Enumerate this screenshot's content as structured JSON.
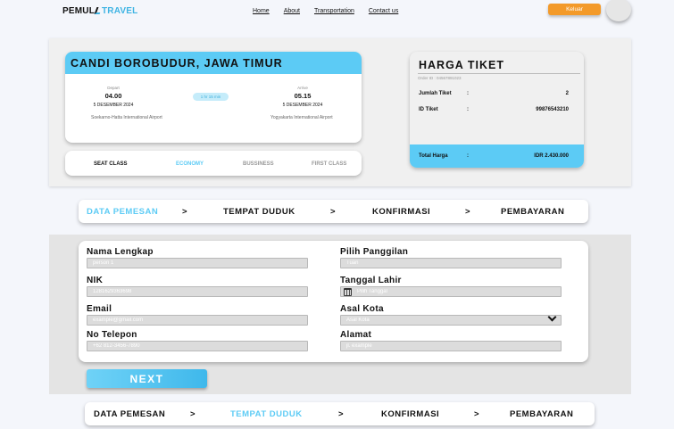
{
  "nav": {
    "logo_part1": "PEMUL",
    "logo_part2": "TRAVEL",
    "links": [
      "Home",
      "About",
      "Transportation",
      "Contact us"
    ],
    "logout_label": "Keluar"
  },
  "trip": {
    "title": "CANDI BOROBUDUR, JAWA TIMUR",
    "depart_label": "Depart",
    "depart_time": "04.00",
    "depart_date": "5 DESEMBER 2024",
    "depart_airport": "Soekarno-Hatta International Airport",
    "duration": "1 hr 15 min",
    "arrive_label": "Arrive",
    "arrive_time": "05.15",
    "arrive_date": "5 DESEMBER 2024",
    "arrive_airport": "Yogyakarta International Airport"
  },
  "classes": {
    "seat_label": "SEAT CLASS",
    "options": [
      "ECONOMY",
      "BUSSINESS",
      "FIRST CLASS"
    ],
    "selected": "ECONOMY"
  },
  "price": {
    "title": "HARGA TIKET",
    "order_id": "Order ID : 04567891023",
    "rows": [
      {
        "label": "Jumlah Tiket",
        "value": "2"
      },
      {
        "label": "ID Tiket",
        "value": "99876543210"
      }
    ],
    "total_label": "Total Harga",
    "total_value": "IDR 2.430.000",
    "separator": ":"
  },
  "steps": {
    "items": [
      "DATA PEMESAN",
      "TEMPAT DUDUK",
      "KONFIRMASI",
      "PEMBAYARAN"
    ],
    "arrow": ">"
  },
  "form": {
    "nama": {
      "label": "Nama Lengkap",
      "placeholder": "person 1"
    },
    "panggilan": {
      "label": "Pilih Panggilan",
      "placeholder": "Tuan"
    },
    "nik": {
      "label": "NIK",
      "placeholder": "1281629363698"
    },
    "tanggal": {
      "label": "Tanggal Lahir",
      "placeholder": "Pilih Tanggal"
    },
    "email": {
      "label": "Email",
      "placeholder": "example@gmail.com"
    },
    "kota": {
      "label": "Asal Kota",
      "placeholder": "Asal Kota"
    },
    "telepon": {
      "label": "No Telepon",
      "placeholder": "+62 812-3456-7890"
    },
    "alamat": {
      "label": "Alamat",
      "placeholder": "jl. example"
    },
    "next_label": "NEXT"
  },
  "colors": {
    "accent": "#5ccbf5",
    "logout": "#f39a2a"
  }
}
